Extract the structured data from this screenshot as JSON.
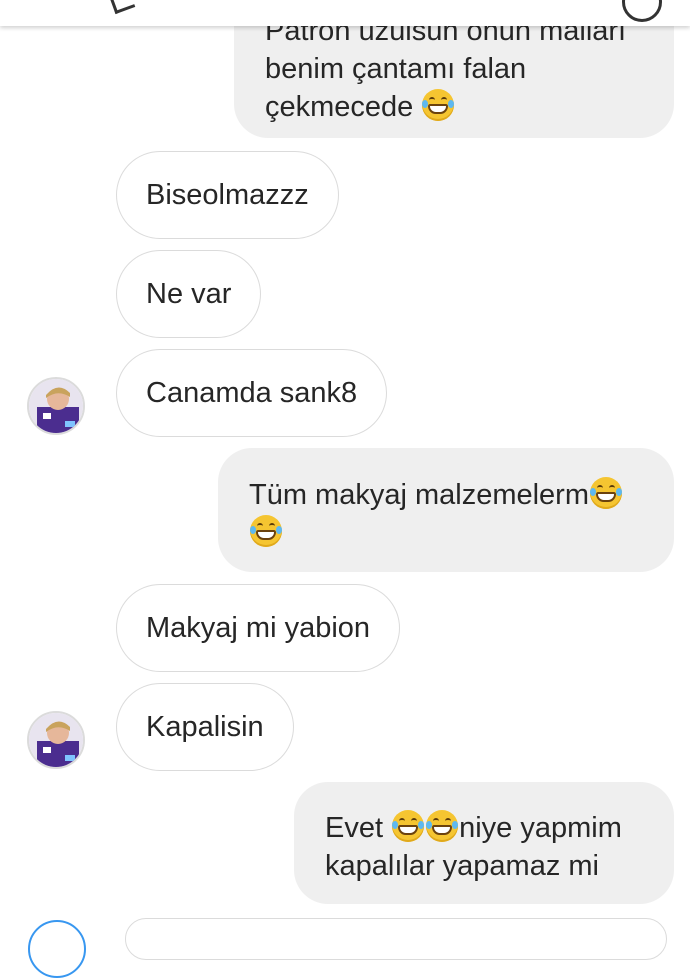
{
  "thread": {
    "messages": [
      {
        "side": "out",
        "lines": [
          "Patron üzülsün onun malları",
          "benim çantamı falan",
          "çekmecede"
        ],
        "emoji_after_last": 1
      },
      {
        "side": "in",
        "text": "Biseolmazzz"
      },
      {
        "side": "in",
        "text": "Ne var"
      },
      {
        "side": "in",
        "text": "Canamda sank8",
        "avatar": true
      },
      {
        "side": "out",
        "lines": [
          "Tüm makyaj malzemelerm",
          ""
        ],
        "emoji_line1": 1,
        "emoji_line2": 1
      },
      {
        "side": "in",
        "text": "Makyaj mi yabion"
      },
      {
        "side": "in",
        "text": "Kapalisin",
        "avatar": true
      },
      {
        "side": "out",
        "lines": [
          "Evet",
          "niye yapmim",
          "kapalılar yapamaz mi"
        ]
      }
    ]
  },
  "icons": {
    "emoji": "face-with-tears-of-joy-icon",
    "avatar": "user-avatar",
    "camera": "camera-icon"
  },
  "colors": {
    "incoming_border": "#dbdbdb",
    "outgoing_bg": "#efefef",
    "text": "#262626",
    "accent": "#3897f0"
  }
}
